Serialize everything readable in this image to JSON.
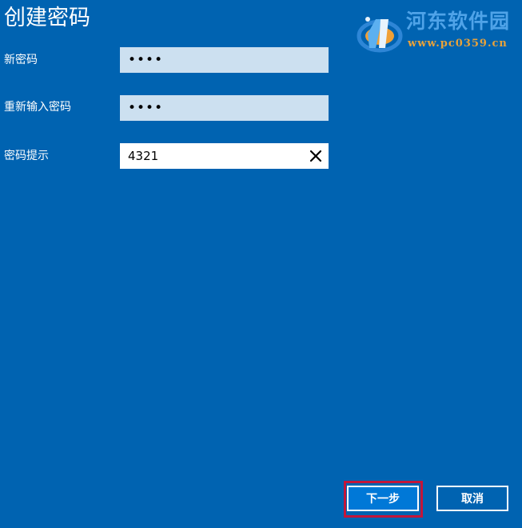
{
  "page": {
    "title": "创建密码"
  },
  "form": {
    "new_password": {
      "label": "新密码",
      "value": "••••"
    },
    "confirm_password": {
      "label": "重新输入密码",
      "value": "••••"
    },
    "password_hint": {
      "label": "密码提示",
      "value": "4321",
      "clear_icon": "close-icon"
    }
  },
  "buttons": {
    "next": "下一步",
    "cancel": "取消"
  },
  "watermark": {
    "name": "河东软件园",
    "url": "www.pc0359.cn"
  },
  "colors": {
    "background": "#0063B1",
    "field_inactive": "#CCE0F0",
    "field_active": "#FFFFFF",
    "primary_button": "#0078D7",
    "highlight": "#C3163A"
  }
}
